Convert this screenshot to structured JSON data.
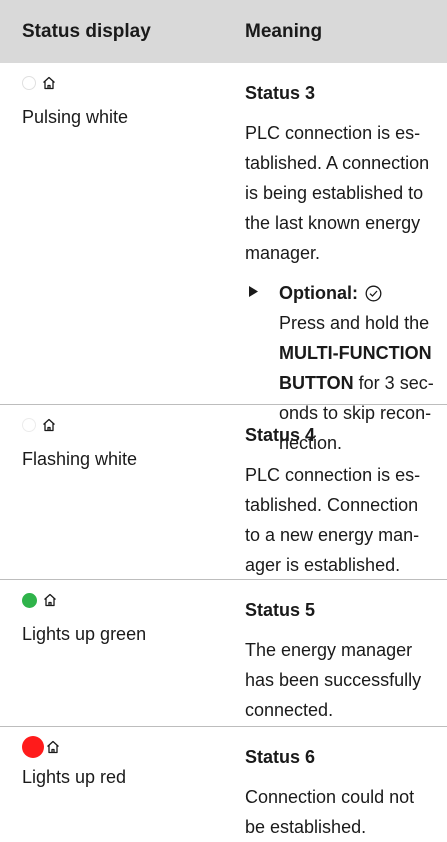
{
  "header": {
    "col1": "Status display",
    "col2": "Meaning"
  },
  "rows": [
    {
      "color_label": "Pulsing white",
      "status": "Status 3",
      "desc_lines": [
        "PLC connection is es-",
        "tablished. A connection",
        "is being established to",
        "the last known energy",
        "manager."
      ],
      "optional": {
        "label": "Optional:",
        "line1": "Press and hold the",
        "bold_lines": [
          "MULTI-FUNCTION",
          "BUTTON"
        ],
        "tail_lines": [
          " for 3 sec-",
          "onds to skip recon-",
          "nection."
        ]
      }
    },
    {
      "color_label": "Flashing white",
      "status": "Status 4",
      "desc_lines": [
        "PLC connection is es-",
        "tablished. Connection",
        "to a new energy man-",
        "ager is established."
      ]
    },
    {
      "color_label": "Lights up green",
      "status": "Status 5",
      "desc_lines": [
        "The energy manager",
        "has been successfully",
        "connected."
      ]
    },
    {
      "color_label": "Lights up red",
      "status": "Status 6",
      "desc_lines": [
        "Connection could not",
        "be established."
      ]
    }
  ],
  "colors": {
    "green": "#2fb34a",
    "red": "#ff1b1b",
    "header_bg": "#d9d9d9"
  },
  "icons": {
    "home": "home-icon",
    "check": "check-circle-icon",
    "arrow": "triangle-right-icon"
  }
}
